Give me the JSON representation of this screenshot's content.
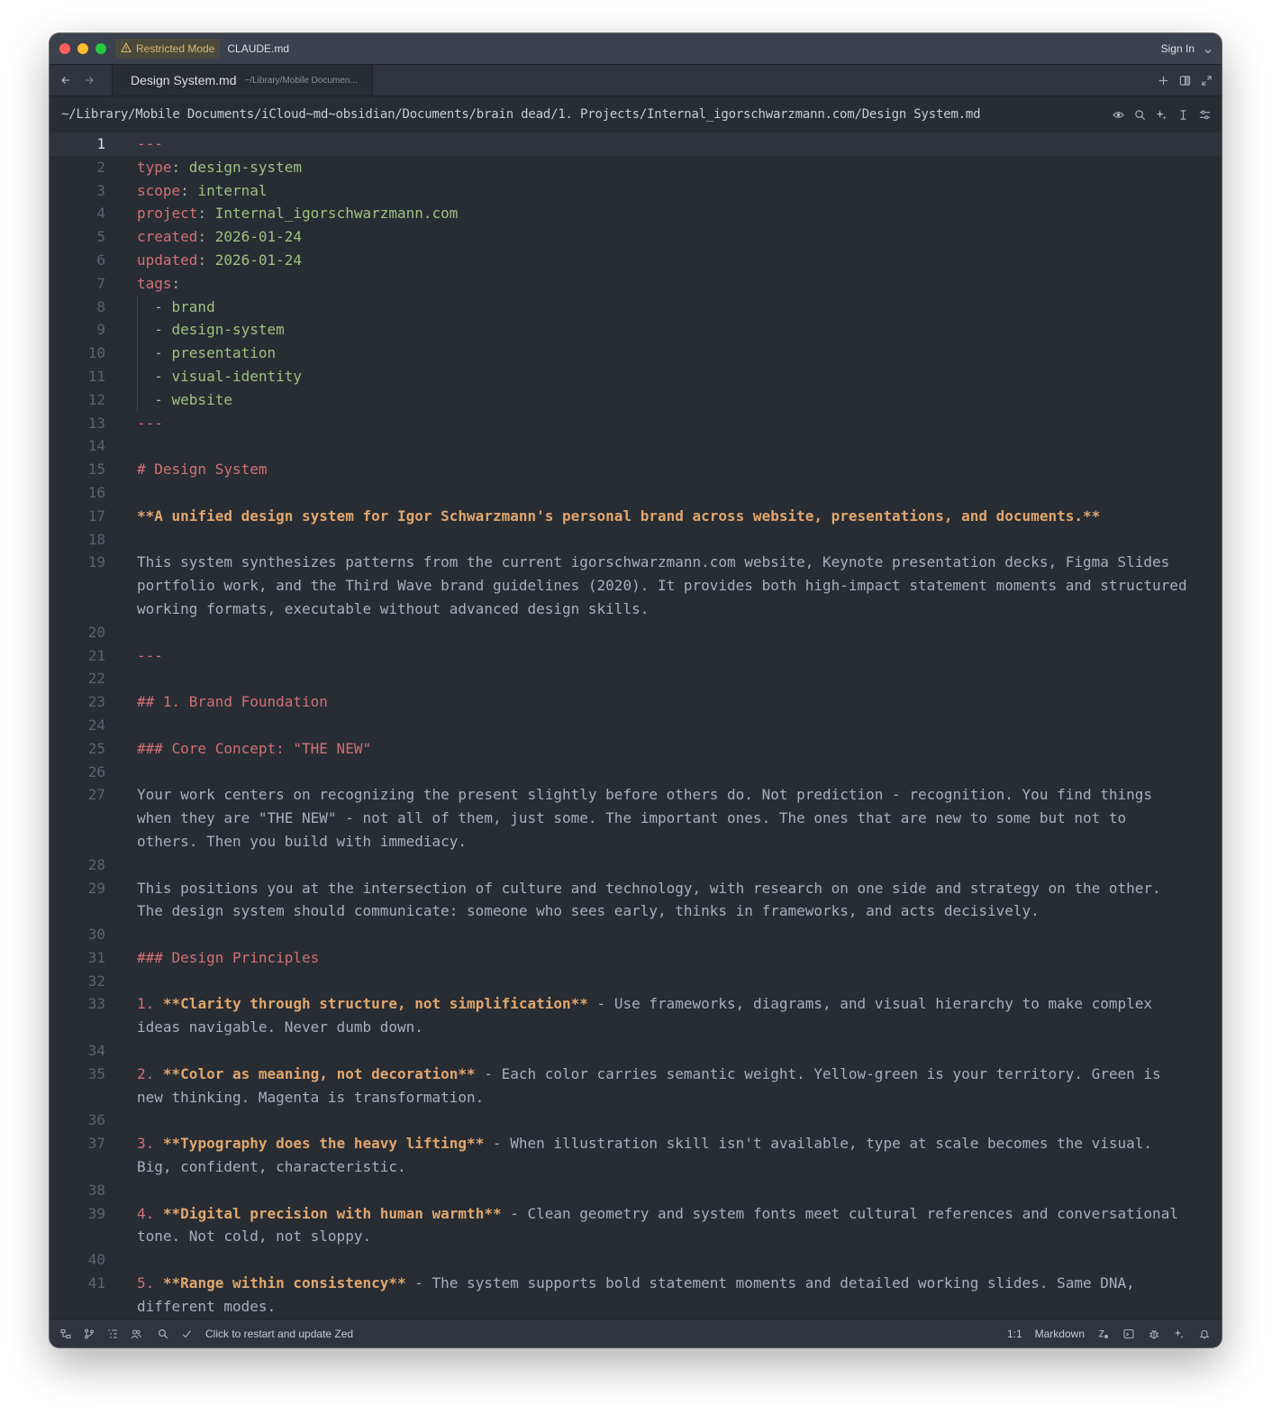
{
  "titlebar": {
    "restricted_label": "Restricted Mode",
    "project": "CLAUDE.md",
    "signin": "Sign In"
  },
  "tab": {
    "title": "Design System.md",
    "path": "~/Library/Mobile Documen..."
  },
  "breadcrumb": "~/Library/Mobile Documents/iCloud~md~obsidian/Documents/brain dead/1. Projects/Internal_igorschwarzmann.com/Design System.md",
  "editor": {
    "active_line": 1,
    "lines": [
      {
        "n": "1",
        "parts": [
          {
            "t": "---",
            "c": "hr"
          }
        ]
      },
      {
        "n": "2",
        "parts": [
          {
            "t": "type",
            "c": "key"
          },
          {
            "t": ": ",
            "c": "plain"
          },
          {
            "t": "design-system",
            "c": "val"
          }
        ]
      },
      {
        "n": "3",
        "parts": [
          {
            "t": "scope",
            "c": "key"
          },
          {
            "t": ": ",
            "c": "plain"
          },
          {
            "t": "internal",
            "c": "val"
          }
        ]
      },
      {
        "n": "4",
        "parts": [
          {
            "t": "project",
            "c": "key"
          },
          {
            "t": ": ",
            "c": "plain"
          },
          {
            "t": "Internal_igorschwarzmann.com",
            "c": "val"
          }
        ]
      },
      {
        "n": "5",
        "parts": [
          {
            "t": "created",
            "c": "key"
          },
          {
            "t": ": ",
            "c": "plain"
          },
          {
            "t": "2026-01-24",
            "c": "val"
          }
        ]
      },
      {
        "n": "6",
        "parts": [
          {
            "t": "updated",
            "c": "key"
          },
          {
            "t": ": ",
            "c": "plain"
          },
          {
            "t": "2026-01-24",
            "c": "val"
          }
        ]
      },
      {
        "n": "7",
        "parts": [
          {
            "t": "tags",
            "c": "key"
          },
          {
            "t": ":",
            "c": "plain"
          }
        ]
      },
      {
        "n": "8",
        "guide": true,
        "parts": [
          {
            "t": "  - ",
            "c": "plain"
          },
          {
            "t": "brand",
            "c": "val"
          }
        ]
      },
      {
        "n": "9",
        "guide": true,
        "parts": [
          {
            "t": "  - ",
            "c": "plain"
          },
          {
            "t": "design-system",
            "c": "val"
          }
        ]
      },
      {
        "n": "10",
        "guide": true,
        "parts": [
          {
            "t": "  - ",
            "c": "plain"
          },
          {
            "t": "presentation",
            "c": "val"
          }
        ]
      },
      {
        "n": "11",
        "guide": true,
        "parts": [
          {
            "t": "  - ",
            "c": "plain"
          },
          {
            "t": "visual-identity",
            "c": "val"
          }
        ]
      },
      {
        "n": "12",
        "guide": true,
        "parts": [
          {
            "t": "  - ",
            "c": "plain"
          },
          {
            "t": "website",
            "c": "val"
          }
        ]
      },
      {
        "n": "13",
        "parts": [
          {
            "t": "---",
            "c": "hr"
          }
        ]
      },
      {
        "n": "14",
        "parts": []
      },
      {
        "n": "15",
        "parts": [
          {
            "t": "# Design System",
            "c": "h"
          }
        ]
      },
      {
        "n": "16",
        "parts": []
      },
      {
        "n": "17",
        "parts": [
          {
            "t": "**A unified design system for Igor Schwarzmann's personal brand across website, presentations, and documents.**",
            "c": "bold"
          }
        ]
      },
      {
        "n": "18",
        "parts": []
      },
      {
        "n": "19",
        "parts": [
          {
            "t": "This system synthesizes patterns from the current igorschwarzmann.com website, Keynote presentation decks, Figma Slides portfolio work, and the Third Wave brand guidelines (2020). It provides both high-impact statement moments and structured working formats, executable without advanced design skills.",
            "c": "plain"
          }
        ]
      },
      {
        "n": "20",
        "parts": []
      },
      {
        "n": "21",
        "parts": [
          {
            "t": "---",
            "c": "hr"
          }
        ]
      },
      {
        "n": "22",
        "parts": []
      },
      {
        "n": "23",
        "parts": [
          {
            "t": "## 1. Brand Foundation",
            "c": "h"
          }
        ]
      },
      {
        "n": "24",
        "parts": []
      },
      {
        "n": "25",
        "parts": [
          {
            "t": "### Core Concept: \"THE NEW\"",
            "c": "h"
          }
        ]
      },
      {
        "n": "26",
        "parts": []
      },
      {
        "n": "27",
        "parts": [
          {
            "t": "Your work centers on recognizing the present slightly before others do. Not prediction - recognition. You find things when they are \"THE NEW\" - not all of them, just some. The important ones. The ones that are new to some but not to others. Then you build with immediacy.",
            "c": "plain"
          }
        ]
      },
      {
        "n": "28",
        "parts": []
      },
      {
        "n": "29",
        "parts": [
          {
            "t": "This positions you at the intersection of culture and technology, with research on one side and strategy on the other. The design system should communicate: someone who sees early, thinks in frameworks, and acts decisively.",
            "c": "plain"
          }
        ]
      },
      {
        "n": "30",
        "parts": []
      },
      {
        "n": "31",
        "parts": [
          {
            "t": "### Design Principles",
            "c": "h"
          }
        ]
      },
      {
        "n": "32",
        "parts": []
      },
      {
        "n": "33",
        "parts": [
          {
            "t": "1. ",
            "c": "hmark"
          },
          {
            "t": "**Clarity through structure, not simplification**",
            "c": "bold"
          },
          {
            "t": " - Use frameworks, diagrams, and visual hierarchy to make complex ideas navigable. Never dumb down.",
            "c": "plain"
          }
        ]
      },
      {
        "n": "34",
        "parts": []
      },
      {
        "n": "35",
        "parts": [
          {
            "t": "2. ",
            "c": "hmark"
          },
          {
            "t": "**Color as meaning, not decoration**",
            "c": "bold"
          },
          {
            "t": " - Each color carries semantic weight. Yellow-green is your territory. Green is new thinking. Magenta is transformation.",
            "c": "plain"
          }
        ]
      },
      {
        "n": "36",
        "parts": []
      },
      {
        "n": "37",
        "parts": [
          {
            "t": "3. ",
            "c": "hmark"
          },
          {
            "t": "**Typography does the heavy lifting**",
            "c": "bold"
          },
          {
            "t": " - When illustration skill isn't available, type at scale becomes the visual. Big, confident, characteristic.",
            "c": "plain"
          }
        ]
      },
      {
        "n": "38",
        "parts": []
      },
      {
        "n": "39",
        "parts": [
          {
            "t": "4. ",
            "c": "hmark"
          },
          {
            "t": "**Digital precision with human warmth**",
            "c": "bold"
          },
          {
            "t": " - Clean geometry and system fonts meet cultural references and conversational tone. Not cold, not sloppy.",
            "c": "plain"
          }
        ]
      },
      {
        "n": "40",
        "parts": []
      },
      {
        "n": "41",
        "parts": [
          {
            "t": "5. ",
            "c": "hmark"
          },
          {
            "t": "**Range within consistency**",
            "c": "bold"
          },
          {
            "t": " - The system supports bold statement moments and detailed working slides. Same DNA, different modes.",
            "c": "plain"
          }
        ]
      }
    ]
  },
  "statusbar": {
    "message": "Click to restart and update Zed",
    "cursor": "1:1",
    "language": "Markdown"
  },
  "colors": {
    "background": "#282c33",
    "heading": "#d07277",
    "bold": "#e0a76e",
    "value": "#a1c181",
    "text": "#a9afbc"
  }
}
